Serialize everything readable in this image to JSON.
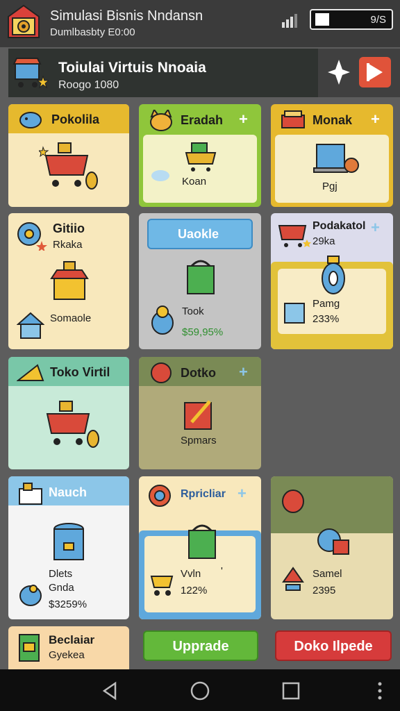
{
  "status": {
    "title": "Simulasi Bisnis Nndansn",
    "subtitle": "Dumlbasbty E0:00",
    "battery": "9/S"
  },
  "banner": {
    "title": "Toiulai Virtuis Nnoaia",
    "subtitle": "Roogo 1080"
  },
  "cards": {
    "c1": {
      "title": "Pokolila"
    },
    "c2": {
      "title": "Eradah",
      "plus": "+",
      "label": "Koan"
    },
    "c3": {
      "title": "Monak",
      "plus": "+",
      "label": "Pgj"
    },
    "c4": {
      "title": "Gitiio",
      "line1": "Rkaka",
      "line2": "Somaole"
    },
    "c5": {
      "title": "Uaokle",
      "label": "Took",
      "price": "$59,95%"
    },
    "c6": {
      "title": "Podakatol",
      "plus": "+",
      "sub": "29ka",
      "label": "Pamg",
      "value": "233%"
    },
    "c7": {
      "title": "Toko Virtil"
    },
    "c8": {
      "title": "Dotko",
      "plus": "+",
      "label": "Spmars"
    },
    "c9": {
      "title": "Nauch",
      "line1": "Dlets",
      "line2": "Gnda",
      "price": "$3259%"
    },
    "c10": {
      "title": "Rpricliar",
      "plus": "+",
      "label": "Vvln",
      "value": "122%",
      "tick": "'"
    },
    "c11": {
      "label": "Samel",
      "value": "2395"
    },
    "c12": {
      "title": "Beclaiar",
      "sub": "Gyekea"
    }
  },
  "buttons": {
    "upgrade": "Upprade",
    "red": "Doko Ilpede"
  },
  "colors": {
    "yellow_head": "#e6b92e",
    "green_card": "#8fc63b",
    "teal_head": "#79c7a8",
    "blue_head": "#8cc6e8",
    "upgrade_green": "#63b83a",
    "red_button": "#d63b3b"
  },
  "icons": {
    "app_logo": "barn-icon",
    "banner": "shopping-cart-icon",
    "star": "sparkle-icon",
    "play": "play-icon"
  }
}
